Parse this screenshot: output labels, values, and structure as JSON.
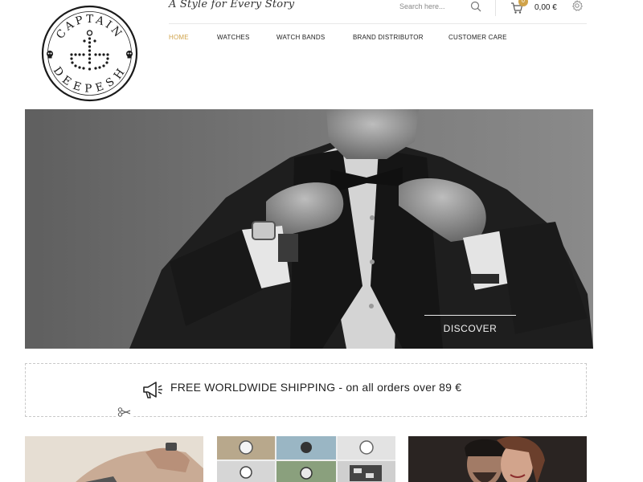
{
  "brand": {
    "logo_top_text": "CAPTAIN",
    "logo_bottom_text": "DEEPESH",
    "tagline": "A Style for Every Story"
  },
  "header": {
    "search": {
      "placeholder": "Search here...",
      "icon": "search-icon"
    },
    "cart": {
      "count": "0",
      "total": "0,00 €",
      "icon": "cart-icon"
    },
    "settings_icon": "gear-icon"
  },
  "nav": {
    "items": [
      {
        "label": "HOME",
        "active": true
      },
      {
        "label": "WATCHES",
        "active": false
      },
      {
        "label": "WATCH BANDS",
        "active": false
      },
      {
        "label": "BRAND DISTRIBUTOR",
        "active": false
      },
      {
        "label": "CUSTOMER CARE",
        "active": false
      }
    ]
  },
  "hero": {
    "button_label": "DISCOVER"
  },
  "shipping": {
    "text": "FREE WORLDWIDE SHIPPING - on all orders over 89 €",
    "icon": "megaphone-icon"
  },
  "colors": {
    "accent": "#d0a34a",
    "text": "#222222",
    "border": "#c9c9c9"
  }
}
